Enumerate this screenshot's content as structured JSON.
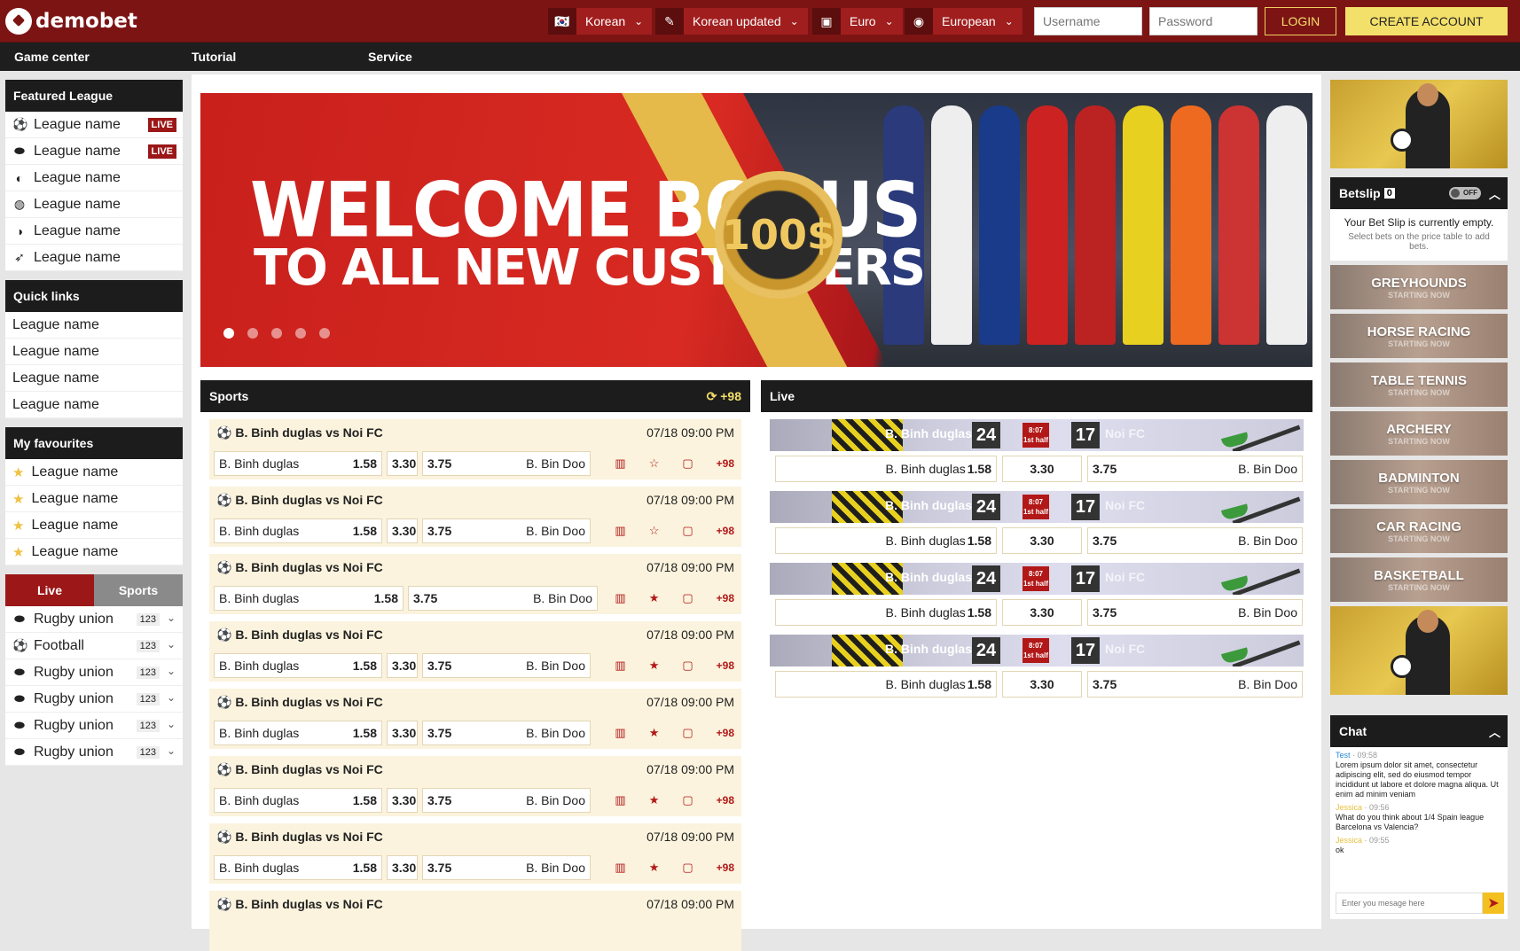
{
  "header": {
    "logo": "demobet",
    "language": "Korean",
    "language_version": "Korean updated",
    "currency": "Euro",
    "odds_format": "European",
    "username_placeholder": "Username",
    "password_placeholder": "Password",
    "login_label": "LOGIN",
    "create_label": "CREATE ACCOUNT"
  },
  "nav": {
    "items": [
      "Game center",
      "Tutorial",
      "Service"
    ]
  },
  "featured": {
    "title": "Featured League",
    "items": [
      {
        "label": "League name",
        "badge": "LIVE",
        "icon": "football-icon"
      },
      {
        "label": "League name",
        "badge": "LIVE",
        "icon": "rugby-icon"
      },
      {
        "label": "League name",
        "icon": "volleyball-icon"
      },
      {
        "label": "League name",
        "icon": "tennis-icon"
      },
      {
        "label": "League name",
        "icon": "basketball-icon"
      },
      {
        "label": "League name",
        "icon": "hockey-icon"
      }
    ]
  },
  "quick_links": {
    "title": "Quick links",
    "items": [
      "League name",
      "League name",
      "League name",
      "League name"
    ]
  },
  "favourites": {
    "title": "My favourites",
    "items": [
      "League name",
      "League name",
      "League name",
      "League name"
    ]
  },
  "tabs": {
    "live": "Live",
    "sports": "Sports"
  },
  "sports_list": [
    {
      "label": "Rugby union",
      "count": "123"
    },
    {
      "label": "Football",
      "count": "123"
    },
    {
      "label": "Rugby union",
      "count": "123"
    },
    {
      "label": "Rugby union",
      "count": "123"
    },
    {
      "label": "Rugby union",
      "count": "123"
    },
    {
      "label": "Rugby union",
      "count": "123"
    }
  ],
  "banner": {
    "line1": "WELCOME BONUS",
    "line2": "TO ALL NEW CUSTOMERS",
    "amount": "100$"
  },
  "sports_section": {
    "title": "Sports",
    "more": "+98"
  },
  "matches": [
    {
      "title": "B. Binh duglas vs Noi FC",
      "date": "07/18 09:00 PM",
      "home": "B. Binh duglas",
      "o1": "1.58",
      "ox": "3.30",
      "o2": "3.75",
      "away": "B. Bin Doo",
      "more": "+98"
    },
    {
      "title": "B. Binh duglas vs Noi FC",
      "date": "07/18 09:00 PM",
      "home": "B. Binh duglas",
      "o1": "1.58",
      "ox": "3.30",
      "o2": "3.75",
      "away": "B. Bin Doo",
      "more": "+98"
    },
    {
      "title": "B. Binh duglas vs Noi FC",
      "date": "07/18 09:00 PM",
      "home": "B. Binh duglas",
      "o1": "1.58",
      "ox": "",
      "o2": "3.75",
      "away": "B. Bin Doo",
      "more": "+98"
    },
    {
      "title": "B. Binh duglas vs Noi FC",
      "date": "07/18 09:00 PM",
      "home": "B. Binh duglas",
      "o1": "1.58",
      "ox": "3.30",
      "o2": "3.75",
      "away": "B. Bin Doo",
      "more": "+98"
    },
    {
      "title": "B. Binh duglas vs Noi FC",
      "date": "07/18 09:00 PM",
      "home": "B. Binh duglas",
      "o1": "1.58",
      "ox": "3.30",
      "o2": "3.75",
      "away": "B. Bin Doo",
      "more": "+98"
    },
    {
      "title": "B. Binh duglas vs Noi FC",
      "date": "07/18 09:00 PM",
      "home": "B. Binh duglas",
      "o1": "1.58",
      "ox": "3.30",
      "o2": "3.75",
      "away": "B. Bin Doo",
      "more": "+98"
    },
    {
      "title": "B. Binh duglas vs Noi FC",
      "date": "07/18 09:00 PM",
      "home": "B. Binh duglas",
      "o1": "1.58",
      "ox": "3.30",
      "o2": "3.75",
      "away": "B. Bin Doo",
      "more": "+98"
    },
    {
      "title": "B. Binh duglas vs Noi FC",
      "date": "07/18 09:00 PM"
    }
  ],
  "live_section": {
    "title": "Live"
  },
  "live_matches": [
    {
      "home": "B. Binh duglas",
      "hs": "24",
      "time": "8:07",
      "period": "1st half",
      "as": "17",
      "away_team": "Noi FC",
      "home_odd": "B. Binh duglas",
      "o1": "1.58",
      "ox": "3.30",
      "o2": "3.75",
      "away": "B. Bin Doo"
    },
    {
      "home": "B. Binh duglas",
      "hs": "24",
      "time": "8:07",
      "period": "1st half",
      "as": "17",
      "away_team": "Noi FC",
      "home_odd": "B. Binh duglas",
      "o1": "1.58",
      "ox": "3.30",
      "o2": "3.75",
      "away": "B. Bin Doo"
    },
    {
      "home": "B. Binh duglas",
      "hs": "24",
      "time": "8:07",
      "period": "1st half",
      "as": "17",
      "away_team": "Noi FC",
      "home_odd": "B. Binh duglas",
      "o1": "1.58",
      "ox": "3.30",
      "o2": "3.75",
      "away": "B. Bin Doo"
    },
    {
      "home": "B. Binh duglas",
      "hs": "24",
      "time": "8:07",
      "period": "1st half",
      "as": "17",
      "away_team": "Noi FC",
      "home_odd": "B. Binh duglas",
      "o1": "1.58",
      "ox": "3.30",
      "o2": "3.75",
      "away": "B. Bin Doo"
    }
  ],
  "betslip": {
    "title": "Betslip",
    "count": "0",
    "toggle": "OFF",
    "empty": "Your Bet Slip is currently empty.",
    "hint": "Select bets on the price table to add bets."
  },
  "sport_cards": [
    {
      "name": "GREYHOUNDS",
      "sub": "STARTING NOW"
    },
    {
      "name": "HORSE RACING",
      "sub": "STARTING NOW"
    },
    {
      "name": "TABLE TENNIS",
      "sub": "STARTING NOW"
    },
    {
      "name": "ARCHERY",
      "sub": "STARTING NOW"
    },
    {
      "name": "BADMINTON",
      "sub": "STARTING NOW"
    },
    {
      "name": "CAR RACING",
      "sub": "STARTING NOW"
    },
    {
      "name": "BASKETBALL",
      "sub": "STARTING NOW"
    }
  ],
  "chat": {
    "title": "Chat",
    "messages": [
      {
        "user": "Test",
        "time": "09:58",
        "text": "Lorem ipsum dolor sit amet, consectetur adipiscing elit, sed do eiusmod tempor incididunt ut labore et dolore magna aliqua. Ut enim ad minim veniam"
      },
      {
        "user": "Jessica",
        "time": "09:56",
        "text": "What do you think about 1/4 Spain league Barcelona vs Valencia?"
      },
      {
        "user": "Jessica",
        "time": "09:55",
        "text": "ok"
      }
    ],
    "placeholder": "Enter you mesage here"
  }
}
